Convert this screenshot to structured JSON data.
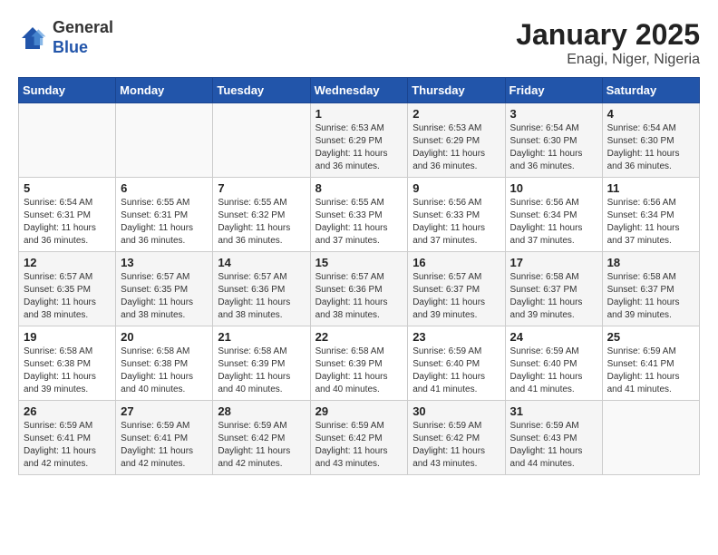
{
  "header": {
    "logo_general": "General",
    "logo_blue": "Blue",
    "title": "January 2025",
    "subtitle": "Enagi, Niger, Nigeria"
  },
  "weekdays": [
    "Sunday",
    "Monday",
    "Tuesday",
    "Wednesday",
    "Thursday",
    "Friday",
    "Saturday"
  ],
  "weeks": [
    [
      {
        "day": "",
        "info": ""
      },
      {
        "day": "",
        "info": ""
      },
      {
        "day": "",
        "info": ""
      },
      {
        "day": "1",
        "info": "Sunrise: 6:53 AM\nSunset: 6:29 PM\nDaylight: 11 hours and 36 minutes."
      },
      {
        "day": "2",
        "info": "Sunrise: 6:53 AM\nSunset: 6:29 PM\nDaylight: 11 hours and 36 minutes."
      },
      {
        "day": "3",
        "info": "Sunrise: 6:54 AM\nSunset: 6:30 PM\nDaylight: 11 hours and 36 minutes."
      },
      {
        "day": "4",
        "info": "Sunrise: 6:54 AM\nSunset: 6:30 PM\nDaylight: 11 hours and 36 minutes."
      }
    ],
    [
      {
        "day": "5",
        "info": "Sunrise: 6:54 AM\nSunset: 6:31 PM\nDaylight: 11 hours and 36 minutes."
      },
      {
        "day": "6",
        "info": "Sunrise: 6:55 AM\nSunset: 6:31 PM\nDaylight: 11 hours and 36 minutes."
      },
      {
        "day": "7",
        "info": "Sunrise: 6:55 AM\nSunset: 6:32 PM\nDaylight: 11 hours and 36 minutes."
      },
      {
        "day": "8",
        "info": "Sunrise: 6:55 AM\nSunset: 6:33 PM\nDaylight: 11 hours and 37 minutes."
      },
      {
        "day": "9",
        "info": "Sunrise: 6:56 AM\nSunset: 6:33 PM\nDaylight: 11 hours and 37 minutes."
      },
      {
        "day": "10",
        "info": "Sunrise: 6:56 AM\nSunset: 6:34 PM\nDaylight: 11 hours and 37 minutes."
      },
      {
        "day": "11",
        "info": "Sunrise: 6:56 AM\nSunset: 6:34 PM\nDaylight: 11 hours and 37 minutes."
      }
    ],
    [
      {
        "day": "12",
        "info": "Sunrise: 6:57 AM\nSunset: 6:35 PM\nDaylight: 11 hours and 38 minutes."
      },
      {
        "day": "13",
        "info": "Sunrise: 6:57 AM\nSunset: 6:35 PM\nDaylight: 11 hours and 38 minutes."
      },
      {
        "day": "14",
        "info": "Sunrise: 6:57 AM\nSunset: 6:36 PM\nDaylight: 11 hours and 38 minutes."
      },
      {
        "day": "15",
        "info": "Sunrise: 6:57 AM\nSunset: 6:36 PM\nDaylight: 11 hours and 38 minutes."
      },
      {
        "day": "16",
        "info": "Sunrise: 6:57 AM\nSunset: 6:37 PM\nDaylight: 11 hours and 39 minutes."
      },
      {
        "day": "17",
        "info": "Sunrise: 6:58 AM\nSunset: 6:37 PM\nDaylight: 11 hours and 39 minutes."
      },
      {
        "day": "18",
        "info": "Sunrise: 6:58 AM\nSunset: 6:37 PM\nDaylight: 11 hours and 39 minutes."
      }
    ],
    [
      {
        "day": "19",
        "info": "Sunrise: 6:58 AM\nSunset: 6:38 PM\nDaylight: 11 hours and 39 minutes."
      },
      {
        "day": "20",
        "info": "Sunrise: 6:58 AM\nSunset: 6:38 PM\nDaylight: 11 hours and 40 minutes."
      },
      {
        "day": "21",
        "info": "Sunrise: 6:58 AM\nSunset: 6:39 PM\nDaylight: 11 hours and 40 minutes."
      },
      {
        "day": "22",
        "info": "Sunrise: 6:58 AM\nSunset: 6:39 PM\nDaylight: 11 hours and 40 minutes."
      },
      {
        "day": "23",
        "info": "Sunrise: 6:59 AM\nSunset: 6:40 PM\nDaylight: 11 hours and 41 minutes."
      },
      {
        "day": "24",
        "info": "Sunrise: 6:59 AM\nSunset: 6:40 PM\nDaylight: 11 hours and 41 minutes."
      },
      {
        "day": "25",
        "info": "Sunrise: 6:59 AM\nSunset: 6:41 PM\nDaylight: 11 hours and 41 minutes."
      }
    ],
    [
      {
        "day": "26",
        "info": "Sunrise: 6:59 AM\nSunset: 6:41 PM\nDaylight: 11 hours and 42 minutes."
      },
      {
        "day": "27",
        "info": "Sunrise: 6:59 AM\nSunset: 6:41 PM\nDaylight: 11 hours and 42 minutes."
      },
      {
        "day": "28",
        "info": "Sunrise: 6:59 AM\nSunset: 6:42 PM\nDaylight: 11 hours and 42 minutes."
      },
      {
        "day": "29",
        "info": "Sunrise: 6:59 AM\nSunset: 6:42 PM\nDaylight: 11 hours and 43 minutes."
      },
      {
        "day": "30",
        "info": "Sunrise: 6:59 AM\nSunset: 6:42 PM\nDaylight: 11 hours and 43 minutes."
      },
      {
        "day": "31",
        "info": "Sunrise: 6:59 AM\nSunset: 6:43 PM\nDaylight: 11 hours and 44 minutes."
      },
      {
        "day": "",
        "info": ""
      }
    ]
  ]
}
